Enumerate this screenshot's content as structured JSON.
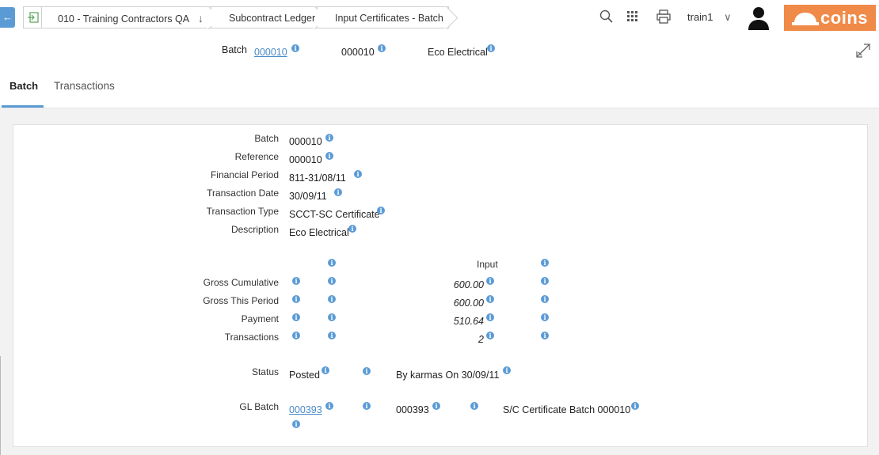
{
  "breadcrumb": {
    "items": [
      "010 - Training Contractors QA",
      "Subcontract Ledger",
      "Input Certificates - Batch"
    ]
  },
  "header_right": {
    "user": "train1",
    "logo": "COiNS"
  },
  "header_strip": {
    "batch_label": "Batch",
    "batch_link": "000010",
    "batch_ref": "000010",
    "description": "Eco Electrical"
  },
  "tabs": [
    "Batch",
    "Transactions"
  ],
  "form": {
    "fields": [
      {
        "label": "Batch",
        "value": "000010"
      },
      {
        "label": "Reference",
        "value": "000010"
      },
      {
        "label": "Financial Period",
        "value": "811-31/08/11"
      },
      {
        "label": "Transaction Date",
        "value": "30/09/11"
      },
      {
        "label": "Transaction Type",
        "value": "SCCT-SC Certificate"
      },
      {
        "label": "Description",
        "value": "Eco Electrical"
      }
    ],
    "totals_header": "Input",
    "totals": [
      {
        "label": "Gross Cumulative",
        "value": "600.00"
      },
      {
        "label": "Gross This Period",
        "value": "600.00"
      },
      {
        "label": "Payment",
        "value": "510.64"
      },
      {
        "label": "Transactions",
        "value": "2"
      }
    ],
    "status_label": "Status",
    "status_value": "Posted",
    "status_by": "By karmas On 30/09/11",
    "gl_label": "GL Batch",
    "gl_link": "000393",
    "gl_ref": "000393",
    "gl_desc": "S/C Certificate Batch 000010"
  },
  "colors": {
    "accent": "#5b9bd5",
    "brand": "#f08a48"
  }
}
